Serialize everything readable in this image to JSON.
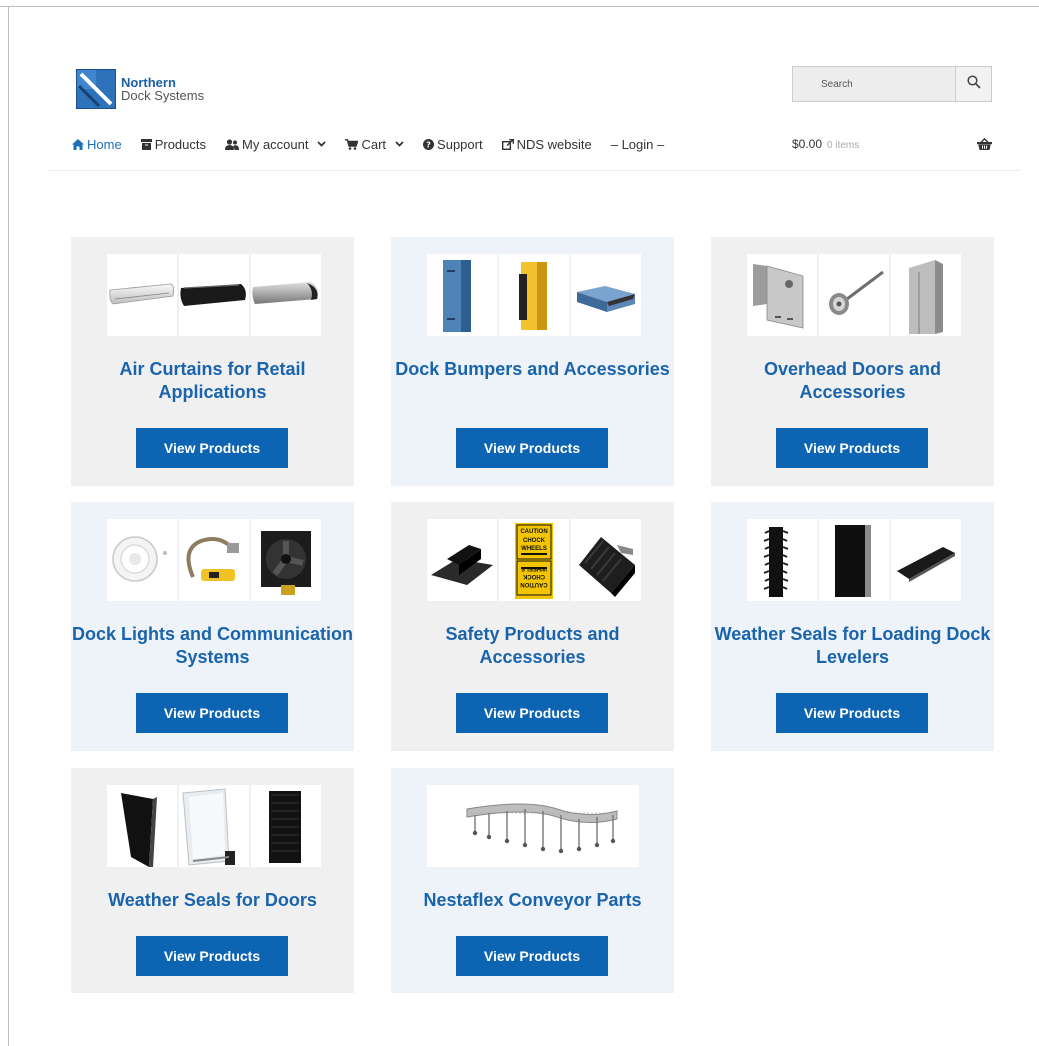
{
  "header": {
    "logo_line1": "Northern",
    "logo_line2": "Dock Systems",
    "search_placeholder": "Search"
  },
  "nav": {
    "home": "Home",
    "products": "Products",
    "account": "My account",
    "cart": "Cart",
    "support": "Support",
    "nds": "NDS website",
    "login": "– Login –",
    "cart_total": "$0.00",
    "cart_items": "0 items"
  },
  "categories": [
    {
      "title": "Air Curtains for Retail Applications",
      "button": "View Products"
    },
    {
      "title": "Dock Bumpers and Accessories",
      "button": "View Products"
    },
    {
      "title": "Overhead Doors and Accessories",
      "button": "View Products"
    },
    {
      "title": "Dock Lights and Communication Systems",
      "button": "View Products"
    },
    {
      "title": "Safety Products and Accessories",
      "button": "View Products"
    },
    {
      "title": "Weather Seals for Loading Dock Levelers",
      "button": "View Products"
    },
    {
      "title": "Weather Seals for Doors",
      "button": "View Products"
    },
    {
      "title": "Nestaflex Conveyor Parts",
      "button": "View Products"
    }
  ],
  "sign_text": [
    "CAUTION",
    "CHOCK",
    "WHEELS"
  ],
  "colors": {
    "accent": "#1a64ad",
    "button": "#0d64b2",
    "card_gray": "#f0f0f0",
    "card_blue": "#edf3f9"
  }
}
